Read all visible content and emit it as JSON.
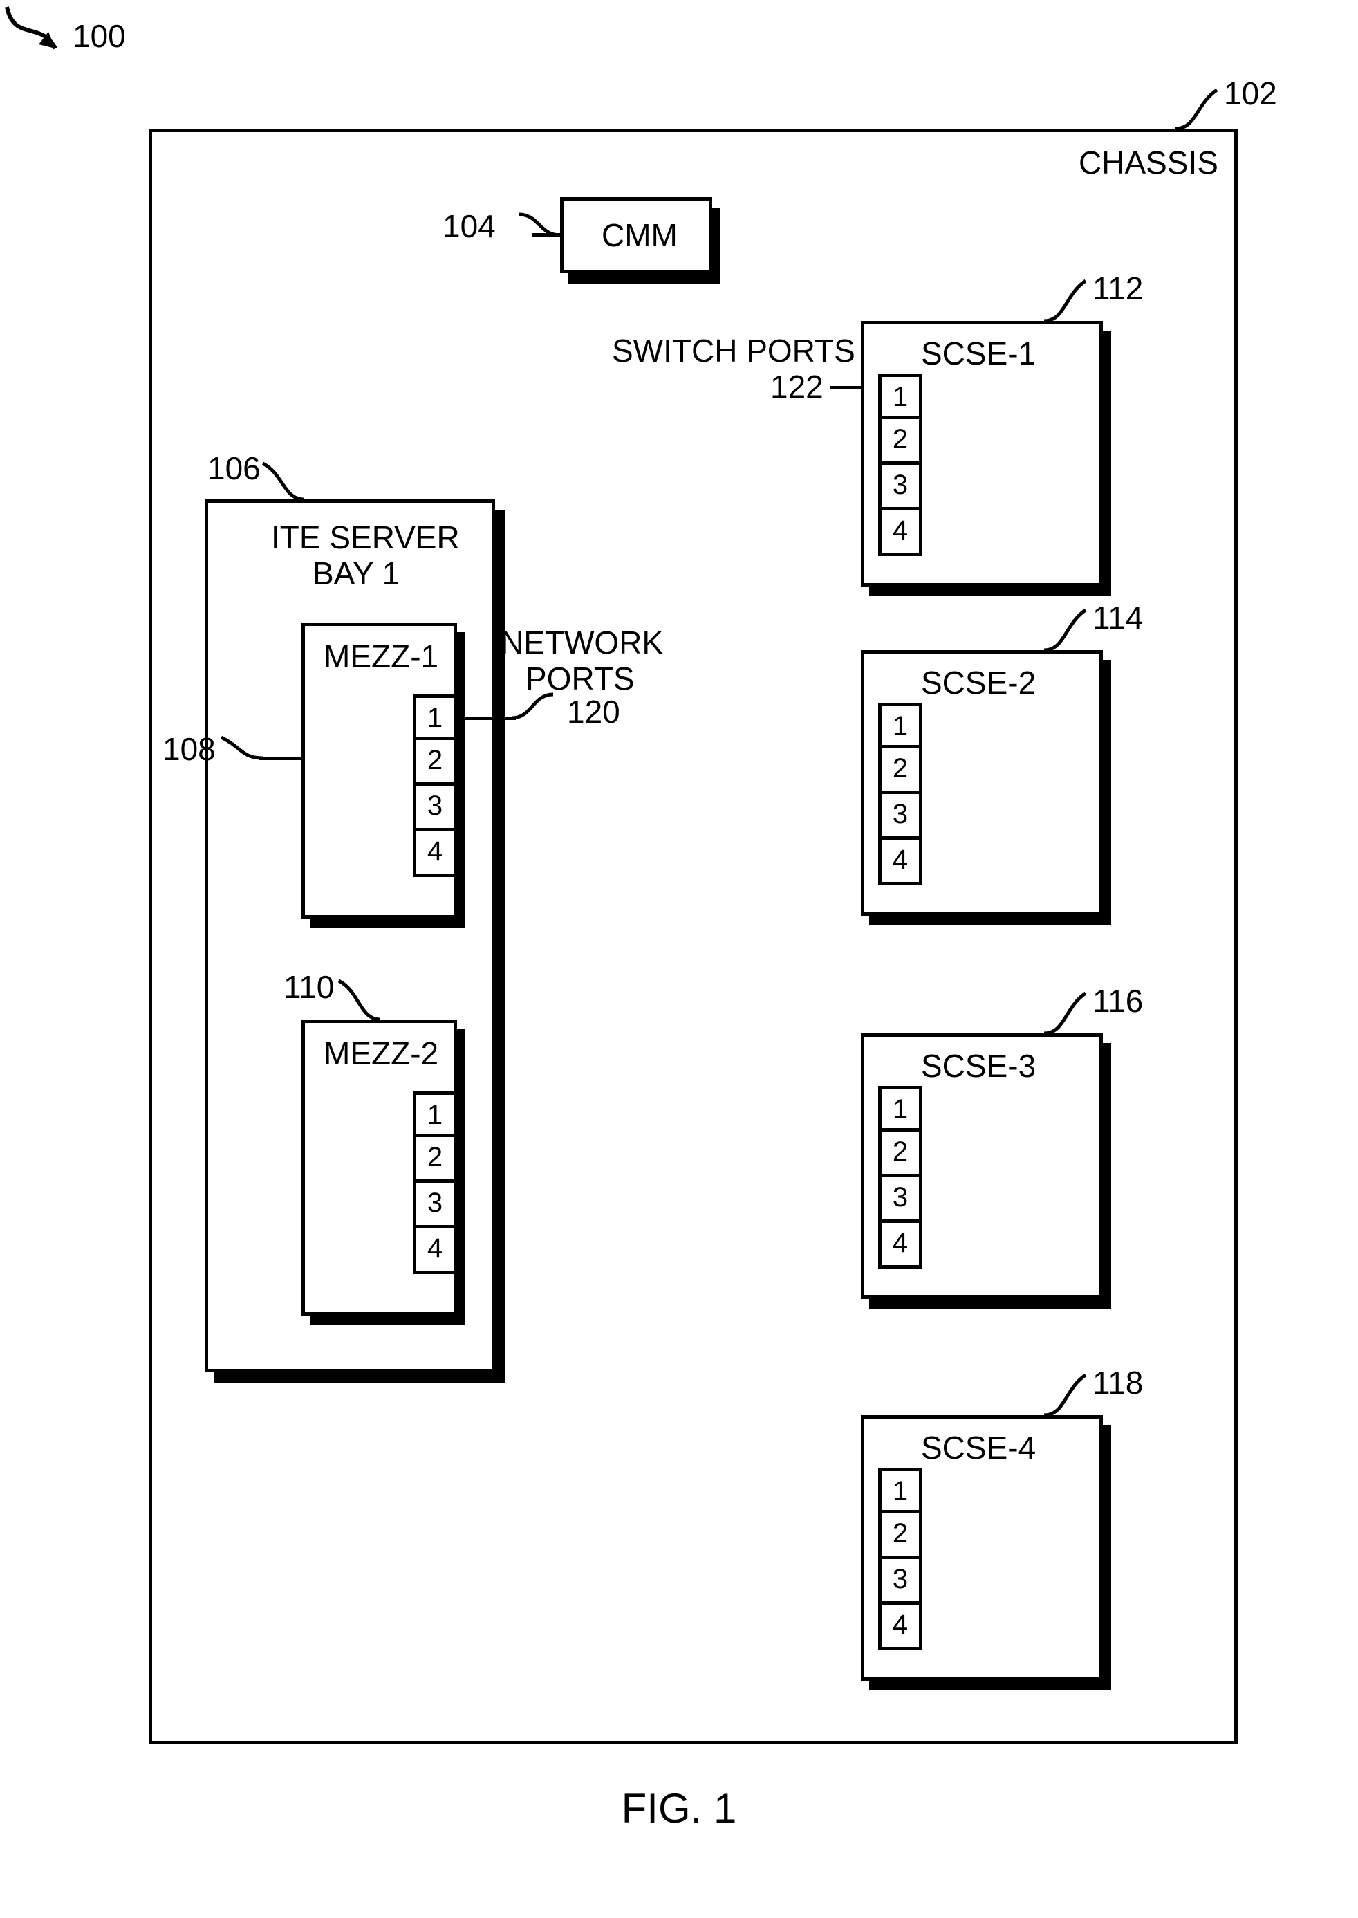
{
  "fig": {
    "caption": "FIG. 1"
  },
  "refs": {
    "r100": "100",
    "r102": "102",
    "r104": "104",
    "r106": "106",
    "r108": "108",
    "r110": "110",
    "r112": "112",
    "r114": "114",
    "r116": "116",
    "r118": "118",
    "r120": "120",
    "r122": "122"
  },
  "labels": {
    "chassis": "CHASSIS",
    "cmm": "CMM",
    "ite_line1": "ITE SERVER",
    "ite_line2": "BAY 1",
    "mezz1": "MEZZ-1",
    "mezz2": "MEZZ-2",
    "network_ports_l1": "NETWORK",
    "network_ports_l2": "PORTS",
    "switch_ports": "SWITCH PORTS",
    "scse1": "SCSE-1",
    "scse2": "SCSE-2",
    "scse3": "SCSE-3",
    "scse4": "SCSE-4"
  },
  "ports": {
    "p1": "1",
    "p2": "2",
    "p3": "3",
    "p4": "4"
  }
}
